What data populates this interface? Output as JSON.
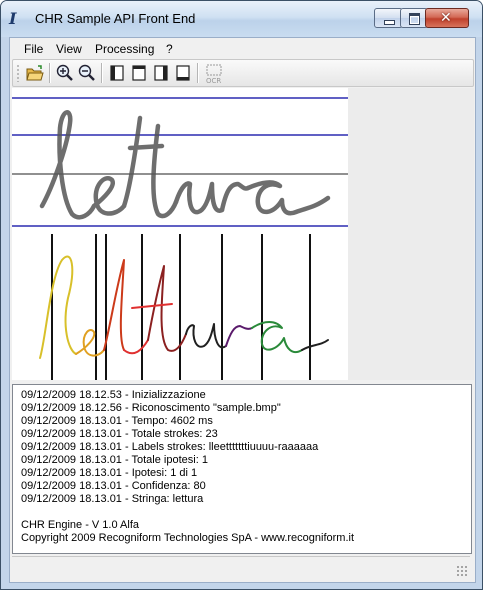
{
  "window": {
    "title": "CHR Sample API Front End",
    "icon": "app-icon"
  },
  "menu": {
    "items": [
      "File",
      "View",
      "Processing",
      "?"
    ]
  },
  "toolbar": {
    "buttons": [
      "open-folder-icon",
      "zoom-in-icon",
      "zoom-out-icon",
      "page-icon",
      "page-icon",
      "page-icon",
      "page-icon",
      "ocr-icon"
    ],
    "ocr_label": "OCR"
  },
  "canvas": {
    "sample_word": "lettura",
    "guide_line_color": "#2b2bb0",
    "stroke_colors": [
      "#d8c02a",
      "#e0a020",
      "#cc3a1a",
      "#e03030",
      "#5a1a6b",
      "#202020",
      "#2a8a3a",
      "#e07040"
    ]
  },
  "log": {
    "lines": [
      "09/12/2009 18.12.53 - Inizializzazione",
      "09/12/2009 18.12.56 - Riconoscimento \"sample.bmp\"",
      "09/12/2009 18.13.01 - Tempo: 4602 ms",
      "09/12/2009 18.13.01 - Totale strokes: 23",
      "09/12/2009 18.13.01 - Labels strokes: lleetttttttiuuuu-raaaaaa",
      "09/12/2009 18.13.01 - Totale ipotesi: 1",
      "09/12/2009 18.13.01 - Ipotesi: 1 di 1",
      "09/12/2009 18.13.01 - Confidenza: 80",
      "09/12/2009 18.13.01 - Stringa: lettura"
    ],
    "engine": "CHR Engine - V 1.0 Alfa",
    "copyright": "Copyright 2009 Recogniform Technologies SpA - www.recogniform.it"
  }
}
